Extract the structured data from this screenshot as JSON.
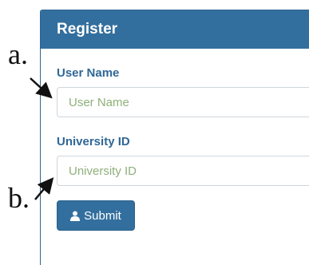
{
  "panel": {
    "title": "Register"
  },
  "form": {
    "username": {
      "label": "User Name",
      "placeholder": "User Name",
      "value": ""
    },
    "university_id": {
      "label": "University ID",
      "placeholder": "University ID",
      "value": ""
    },
    "submit_label": "Submit",
    "submit_icon": "user-icon"
  },
  "annotations": {
    "a": "a.",
    "b": "b."
  },
  "colors": {
    "header_bg": "#336f9e",
    "label": "#2f6796",
    "placeholder": "#8fb07a",
    "button_bg": "#336f9e"
  }
}
